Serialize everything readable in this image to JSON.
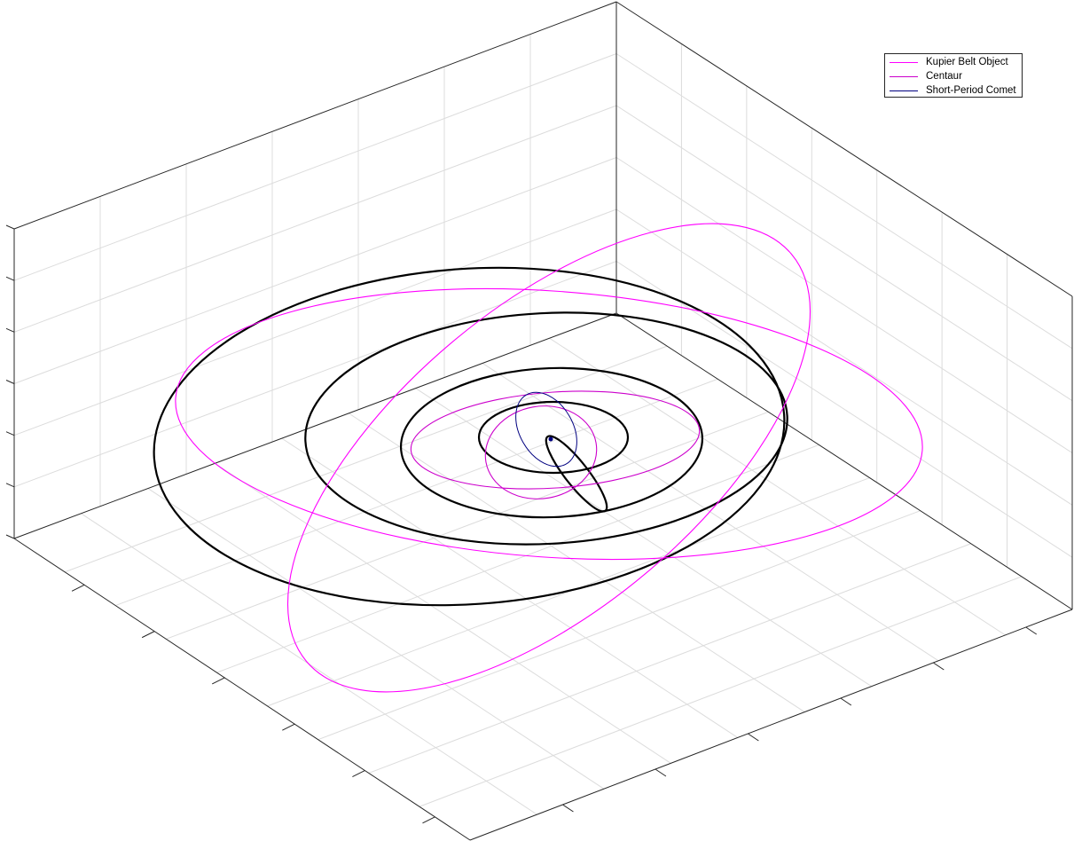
{
  "chart_data": {
    "type": "line",
    "view": "3d-orbit-plot",
    "grid": true,
    "legend_placement": "top-right",
    "axis_tick_labels": "none",
    "series": [
      {
        "name": "Kupier Belt Object",
        "color": "#ff00ff",
        "role": "orbit"
      },
      {
        "name": "Centaur",
        "color": "#cc00cc",
        "role": "orbit"
      },
      {
        "name": "Short-Period Comet",
        "color": "#000080",
        "role": "orbit"
      }
    ],
    "planet_orbits": {
      "color": "#000000",
      "count": 5
    }
  },
  "legend": {
    "items": [
      {
        "label": "Kupier Belt Object",
        "color": "#ff00ff"
      },
      {
        "label": "Centaur",
        "color": "#cc00cc"
      },
      {
        "label": "Short-Period Comet",
        "color": "#000080"
      }
    ]
  }
}
